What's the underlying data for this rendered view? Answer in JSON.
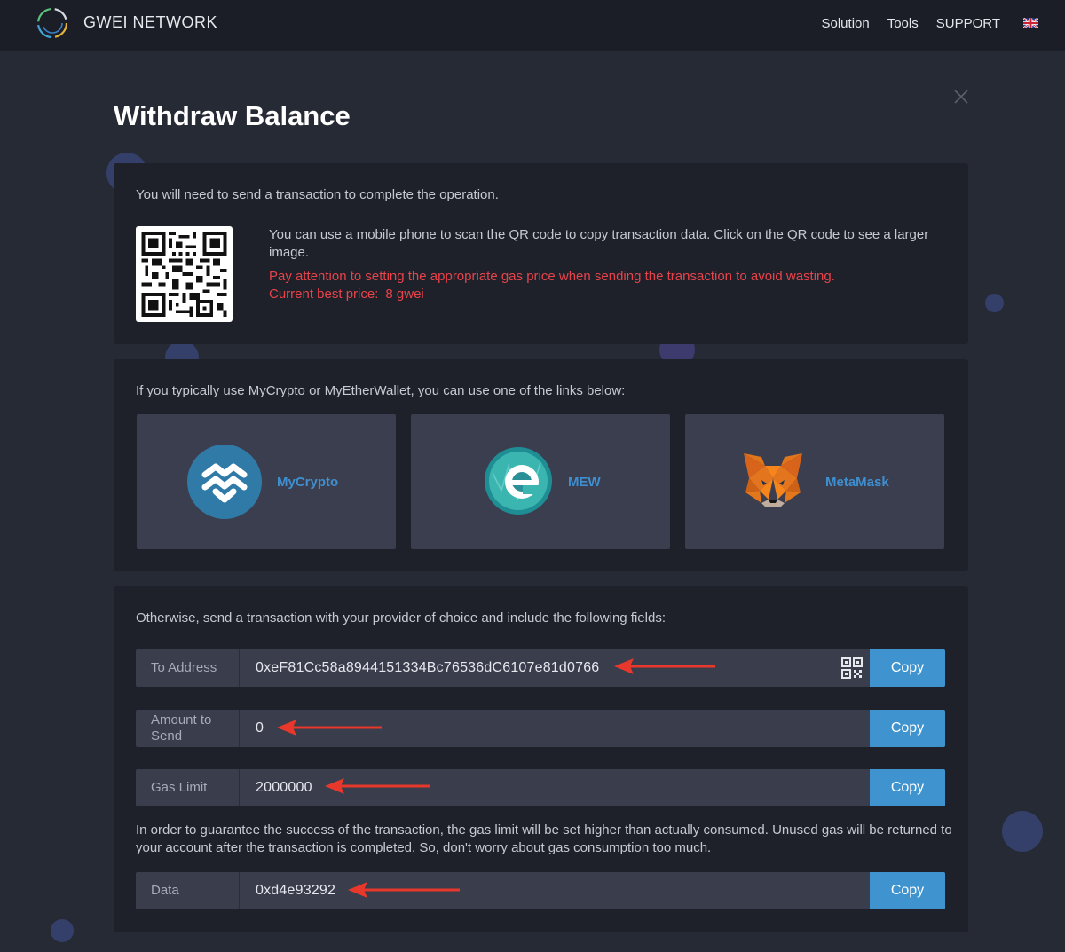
{
  "header": {
    "brand": "GWEI NETWORK",
    "nav": [
      "Solution",
      "Tools",
      "SUPPORT"
    ]
  },
  "dialog": {
    "title": "Withdraw Balance",
    "intro": "You will need to send a transaction to complete the operation.",
    "qr_info": "You can use a mobile phone to scan the QR code to copy transaction data. Click on the QR code to see a larger image.",
    "gas_warning": "Pay attention to setting the appropriate gas price when sending the transaction to avoid wasting.",
    "best_price_label": "Current best price:",
    "best_price_value": "8 gwei",
    "wallets_intro": "If you typically use MyCrypto or MyEtherWallet, you can use one of the links below:",
    "wallets": [
      "MyCrypto",
      "MEW",
      "MetaMask"
    ],
    "fields_intro": "Otherwise, send a transaction with your provider of choice and include the following fields:",
    "fields": [
      {
        "label": "To Address",
        "value": "0xeF81Cc58a8944151334Bc76536dC6107e81d0766",
        "copy": "Copy"
      },
      {
        "label": "Amount to Send",
        "value": "0",
        "copy": "Copy"
      },
      {
        "label": "Gas Limit",
        "value": "2000000",
        "copy": "Copy"
      },
      {
        "label": "Data",
        "value": "0xd4e93292",
        "copy": "Copy"
      }
    ],
    "gas_note": "In order to guarantee the success of the transaction, the gas limit will be set higher than actually consumed. Unused gas will be returned to your account after the transaction is completed. So, don't worry about gas consumption too much."
  },
  "colors": {
    "accent": "#3f94cf",
    "warning": "#e8434b",
    "annotation_arrow": "#e8382c"
  }
}
